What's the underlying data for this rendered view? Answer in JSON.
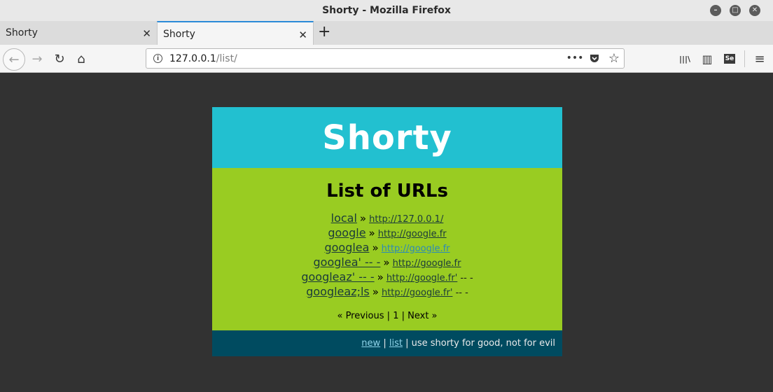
{
  "window": {
    "title": "Shorty - Mozilla Firefox",
    "controls": {
      "minimize": "–",
      "maximize": "□",
      "close": "✕"
    }
  },
  "tabs": [
    {
      "label": "Shorty",
      "close": "✕"
    },
    {
      "label": "Shorty",
      "close": "✕"
    }
  ],
  "newtab": "+",
  "navbar": {
    "back": "←",
    "forward": "→",
    "reload": "↻",
    "home": "⌂",
    "url_host": "127.0.0.1",
    "url_path": "/list/",
    "page_actions": "•••",
    "bookmark": "☆",
    "tool_library": "|||\\",
    "tool_sidebar": "▥",
    "tool_selenium": "Se",
    "tool_menu": "≡"
  },
  "page": {
    "site_title": "Shorty",
    "heading": "List of URLs",
    "urls": [
      {
        "name": "local",
        "url": "http://127.0.0.1/",
        "trail": ""
      },
      {
        "name": "google",
        "url": "http://google.fr",
        "trail": ""
      },
      {
        "name": "googlea",
        "url": "http://google.fr",
        "trail": ""
      },
      {
        "name": "googlea' -- -",
        "url": "http://google.fr",
        "trail": ""
      },
      {
        "name": "googleaz' -- -",
        "url": "http://google.fr'",
        "trail": " -- -"
      },
      {
        "name": "googleaz;ls",
        "url": "http://google.fr'",
        "trail": " -- -"
      }
    ],
    "pager": {
      "previous": "« Previous",
      "sep1": "|",
      "page": "1",
      "sep2": "|",
      "next": "Next »"
    },
    "footer": {
      "new": "new",
      "sep": "|",
      "list": "list",
      "tagline": "| use shorty for good, not for evil"
    }
  },
  "colors": {
    "header": "#22c0d0",
    "main": "#99cc22",
    "footer": "#004b60",
    "background": "#323232"
  }
}
